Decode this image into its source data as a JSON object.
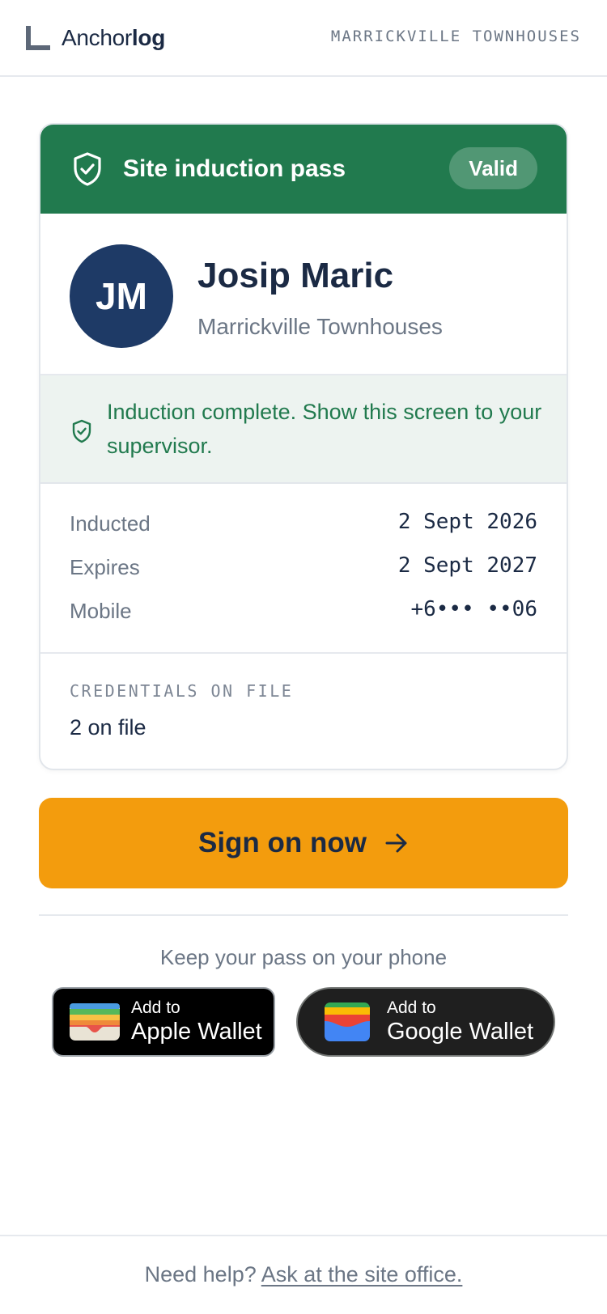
{
  "header": {
    "logo_regular": "Anchor",
    "logo_bold": "log",
    "site_name": "MARRICKVILLE TOWNHOUSES"
  },
  "pass": {
    "title": "Site induction pass",
    "status": "Valid",
    "header_color": "#217a4e",
    "person": {
      "initials": "JM",
      "name": "Josip Maric",
      "site": "Marrickville Townhouses"
    },
    "notice": "Induction complete. Show this screen to your supervisor.",
    "details": [
      {
        "label": "Inducted",
        "value": "2 Sept 2026"
      },
      {
        "label": "Expires",
        "value": "2 Sept 2027"
      },
      {
        "label": "Mobile",
        "value": "+6••• ••06"
      }
    ],
    "credentials": {
      "label": "CREDENTIALS ON FILE",
      "value": "2 on file"
    }
  },
  "cta": {
    "label": "Sign on now",
    "icon": "arrow-right-icon",
    "color": "#f39c0d"
  },
  "wallet": {
    "prompt": "Keep your pass on your phone",
    "apple": {
      "small": "Add to",
      "big": "Apple Wallet"
    },
    "google": {
      "small": "Add to",
      "big": "Google Wallet"
    }
  },
  "footer": {
    "text": "Need help?",
    "link": "Ask at the site office."
  }
}
